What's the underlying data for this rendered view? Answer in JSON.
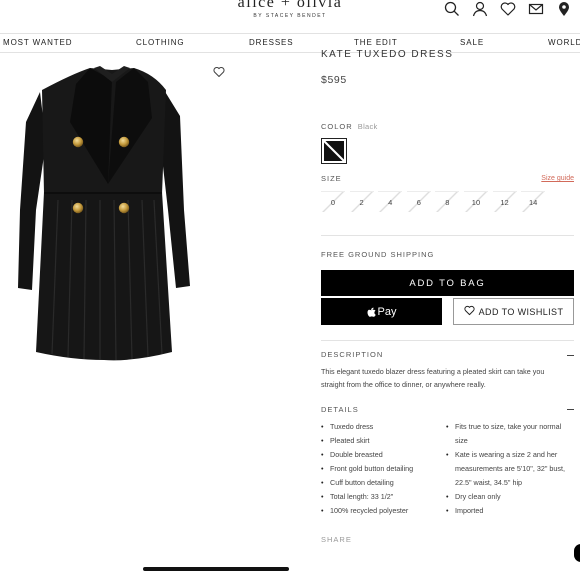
{
  "header": {
    "brand": "alice + olivia",
    "sub": "BY STACEY BENDET",
    "icons": [
      "search-icon",
      "user-icon",
      "heart-icon",
      "mail-icon",
      "location-pin-icon"
    ]
  },
  "nav": [
    "MOST WANTED",
    "CLOTHING",
    "DRESSES",
    "THE EDIT",
    "SALE",
    "WORLD"
  ],
  "product": {
    "title": "KATE TUXEDO DRESS",
    "price": "$595",
    "color_label": "COLOR",
    "color_value": "Black",
    "size_label": "SIZE",
    "size_guide": "Size guide",
    "sizes": [
      "0",
      "2",
      "4",
      "6",
      "8",
      "10",
      "12",
      "14"
    ],
    "shipping": "FREE GROUND SHIPPING",
    "add_to_bag": "ADD TO BAG",
    "apple_pay": "Pay",
    "add_to_wishlist": "ADD TO WISHLIST"
  },
  "description": {
    "heading": "DESCRIPTION",
    "text": "This elegant tuxedo blazer dress featuring a pleated skirt can take you straight from the office to dinner, or anywhere really."
  },
  "details": {
    "heading": "DETAILS",
    "left": [
      "Tuxedo dress",
      "Pleated skirt",
      "Double breasted",
      "Front gold button detailing",
      "Cuff button detailing",
      "Total length: 33 1/2\"",
      "100% recycled polyester"
    ],
    "right": [
      "Fits true to size, take your normal size",
      "Kate is wearing a size 2 and her measurements are 5'10\", 32\" bust, 22.5\" waist, 34.5\" hip",
      "Dry clean only",
      "Imported"
    ]
  },
  "share": "SHARE"
}
